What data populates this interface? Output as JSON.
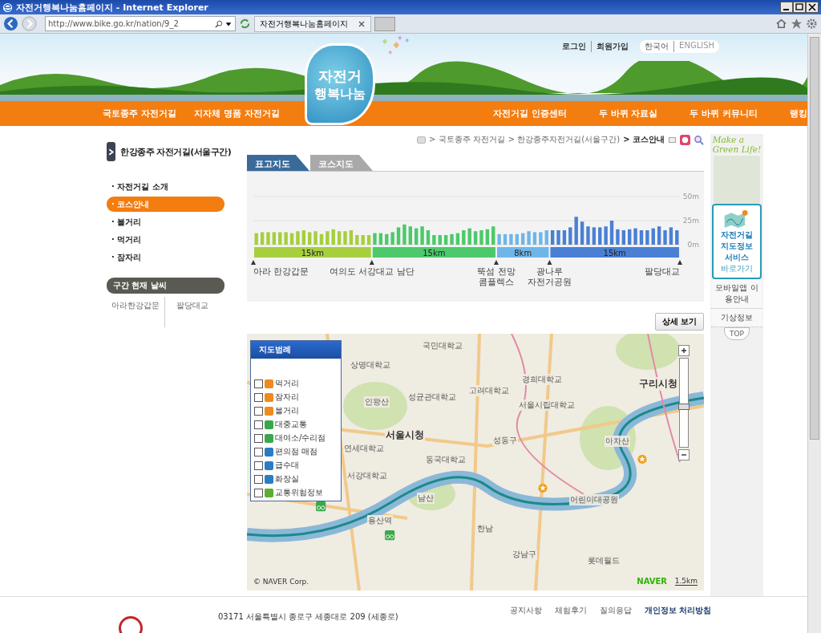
{
  "window": {
    "title": "자전거행복나눔홈페이지 - Internet Explorer"
  },
  "browser": {
    "url": "http://www.bike.go.kr/nation/9_2",
    "tab": "자전거행복나눔홈페이지"
  },
  "header": {
    "top_links": [
      "로그인",
      "회원가입"
    ],
    "languages": [
      {
        "label": "한국어",
        "selected": true
      },
      {
        "label": "ENGLISH",
        "selected": false
      }
    ],
    "logo": [
      "자전거",
      "행복나눔"
    ],
    "nav_left": [
      "국토종주 자전거길",
      "지자체 명품 자전거길"
    ],
    "nav_right": [
      "자전거길 인증센터",
      "두 바퀴 자료실",
      "두 바퀴 커뮤니티",
      "랭킹"
    ]
  },
  "sidebar": {
    "title": "한강종주 자전거길(서울구간)",
    "items": [
      {
        "label": "· 자전거길 소개",
        "selected": false
      },
      {
        "label": "· 코스안내",
        "selected": true
      },
      {
        "label": "· 볼거리",
        "selected": false
      },
      {
        "label": "· 먹거리",
        "selected": false
      },
      {
        "label": "· 잠자리",
        "selected": false
      }
    ],
    "weather": {
      "title": "구간 현재 날씨",
      "places": [
        "아라한강갑문",
        "팔당대교"
      ]
    }
  },
  "breadcrumb": [
    "> 국토종주 자전거길",
    "> 한강종주자전거길(서울구간)",
    "> 코스안내"
  ],
  "tabs": [
    {
      "label": "표고지도",
      "selected": true
    },
    {
      "label": "코스지도",
      "selected": false
    }
  ],
  "elevation": {
    "chart_data": {
      "type": "bar",
      "ylim": [
        0,
        50
      ],
      "yticks": [
        {
          "value": 0,
          "label": "0m"
        },
        {
          "value": 25,
          "label": "25m"
        },
        {
          "value": 50,
          "label": "50m"
        }
      ],
      "series": [
        {
          "color": "#a6cf3c",
          "values": [
            12,
            13,
            13,
            13,
            13,
            13,
            12,
            14,
            15,
            13,
            14,
            11,
            14,
            16,
            14,
            14,
            15,
            10,
            10,
            10,
            null,
            null,
            null,
            null,
            null,
            null,
            null,
            null,
            null,
            null,
            null,
            null,
            null,
            null,
            null,
            null,
            null,
            null,
            null,
            null,
            null,
            null,
            null,
            null,
            null,
            null,
            null,
            null,
            null,
            null,
            null,
            null,
            null,
            null,
            null,
            null,
            null,
            null,
            null,
            null,
            null,
            null,
            null,
            null,
            null,
            null,
            null,
            null,
            null,
            null,
            null,
            null
          ]
        },
        {
          "color": "#4cc96a",
          "values": [
            null,
            null,
            null,
            null,
            null,
            null,
            null,
            null,
            null,
            null,
            null,
            null,
            null,
            null,
            null,
            null,
            null,
            null,
            null,
            null,
            12,
            12,
            11,
            13,
            18,
            21,
            19,
            17,
            19,
            15,
            10,
            10,
            10,
            11,
            12,
            15,
            17,
            14,
            15,
            16,
            19,
            null,
            null,
            null,
            null,
            null,
            null,
            null,
            null,
            null,
            null,
            null,
            null,
            null,
            null,
            null,
            null,
            null,
            null,
            null,
            null,
            null,
            null,
            null,
            null,
            null,
            null,
            null,
            null,
            null,
            null,
            null
          ]
        },
        {
          "color": "#6fb6e8",
          "values": [
            null,
            null,
            null,
            null,
            null,
            null,
            null,
            null,
            null,
            null,
            null,
            null,
            null,
            null,
            null,
            null,
            null,
            null,
            null,
            null,
            null,
            null,
            null,
            null,
            null,
            null,
            null,
            null,
            null,
            null,
            null,
            null,
            null,
            null,
            null,
            null,
            null,
            null,
            null,
            null,
            null,
            11,
            11,
            11,
            11,
            12,
            14,
            13,
            13,
            15,
            null,
            null,
            null,
            null,
            null,
            null,
            null,
            null,
            null,
            null,
            null,
            null,
            null,
            null,
            null,
            null,
            null,
            null,
            null,
            null,
            null,
            null
          ]
        },
        {
          "color": "#4a7fd4",
          "values": [
            null,
            null,
            null,
            null,
            null,
            null,
            null,
            null,
            null,
            null,
            null,
            null,
            null,
            null,
            null,
            null,
            null,
            null,
            null,
            null,
            null,
            null,
            null,
            null,
            null,
            null,
            null,
            null,
            null,
            null,
            null,
            null,
            null,
            null,
            null,
            null,
            null,
            null,
            null,
            null,
            null,
            null,
            null,
            null,
            null,
            null,
            null,
            null,
            null,
            null,
            15,
            15,
            15,
            18,
            29,
            24,
            19,
            18,
            18,
            19,
            25,
            16,
            15,
            16,
            17,
            15,
            15,
            17,
            19,
            15,
            18,
            15
          ]
        }
      ]
    },
    "segments": [
      {
        "label": "15km",
        "color": "#a6cf3c"
      },
      {
        "label": "15km",
        "color": "#4cc96a"
      },
      {
        "label": "8km",
        "color": "#6fb6e8"
      },
      {
        "label": "15km",
        "color": "#4a7fd4"
      }
    ],
    "stops": [
      [
        "아라 한강갑문"
      ],
      [
        "여의도 서강대교 남단"
      ],
      [
        "뚝섬 전망",
        "콤플렉스"
      ],
      [
        "광나루",
        "자전거공원"
      ],
      [
        "팔당대교"
      ]
    ]
  },
  "detail_button": "상세 보기",
  "map": {
    "legend": {
      "title": "지도범례",
      "items": [
        {
          "label": "먹거리",
          "checked": false,
          "color": "#f08a1c"
        },
        {
          "label": "잠자리",
          "checked": false,
          "color": "#f08a1c"
        },
        {
          "label": "볼거리",
          "checked": false,
          "color": "#f08a1c"
        },
        {
          "label": "대중교통",
          "checked": false,
          "color": "#3aa84a"
        },
        {
          "label": "대여소/수리점",
          "checked": false,
          "color": "#3aa84a"
        },
        {
          "label": "편의점 매점",
          "checked": false,
          "color": "#2a7cc4"
        },
        {
          "label": "급수대",
          "checked": false,
          "color": "#2a7cc4"
        },
        {
          "label": "화장실",
          "checked": false,
          "color": "#2a7cc4"
        },
        {
          "label": "교통위험정보",
          "checked": false,
          "color": "#5cae2e"
        }
      ]
    },
    "labels": [
      "국민대학교",
      "상명대학교",
      "성균관대학교",
      "서울시청",
      "구리시청",
      "아차산",
      "인왕산",
      "연세대학교",
      "서강대학교",
      "동국대학교",
      "경희대학교",
      "서울시립대학교",
      "어린이대공원",
      "용산역",
      "한남",
      "롯데월드",
      "고려대학교",
      "남산",
      "성동구",
      "강남구"
    ],
    "zoom": {
      "level": 0.45
    },
    "attribution": "© NAVER Corp.",
    "brand": "NAVER",
    "scale": "1.5km"
  },
  "promo": {
    "slogan": [
      "Make a",
      "Green Life!"
    ],
    "service": [
      "자전거길",
      "지도정보",
      "서비스",
      "바로가기"
    ],
    "links": [
      "모바일앱 이용안내",
      "기상정보"
    ],
    "top": "TOP"
  },
  "footer": {
    "address": "03171 서울특별시 종로구 세종대로 209 (세종로)",
    "links": [
      "공지사항",
      "체험후기",
      "질의응답",
      "개인정보 처리방침"
    ]
  }
}
